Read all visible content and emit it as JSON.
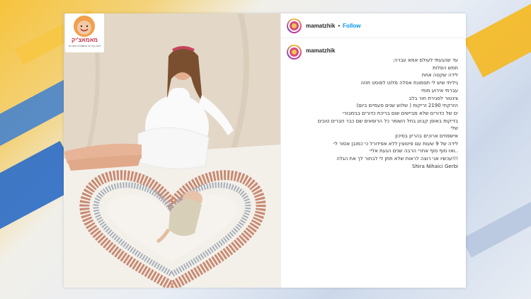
{
  "post": {
    "username": "mamatzhik",
    "separator": "•",
    "follow_label": "Follow",
    "logo_text": "מאמאצ'יק",
    "logo_subtext": "ליגת הכל על המשפחה וההורות",
    "caption_lines": [
      "עד שהגעתי לעולם אמא עברה:",
      "חמש הפלות",
      "לידה שקטה אחת",
      "גיליתי שיש לי תסמונת אפלה מלוט לפוסט חוזה",
      "עברתי אירוע מוחי",
      "צינטור לסגירת חור בלב",
      "הזרקתי 2190 זריקות ( שלוש שנים פעמיים ביום)",
      "ים של כדורים שלא מביישים שום בריכת כדורים בגימבורי",
      "בדיקות באופן קבוע בחל השומר כל הרופאים שם כבר חברים טובים",
      "שלי",
      "אישפוזים ארוכים בהריון בסיכון",
      "לידה של 9 שעות עם פיטוצין ללא אפידורל כי כמובן אסור לי",
      "..ואז סוף סוף אחרי הרבה שנים הגעת אליי",
      "!!!עכשיו אני רוצה לראות שלא תתן לי לבחור לך את הגלה",
      "Shira Nihaici Gerbi"
    ]
  },
  "colors": {
    "follow": "#0095f6",
    "username": "#262626"
  }
}
